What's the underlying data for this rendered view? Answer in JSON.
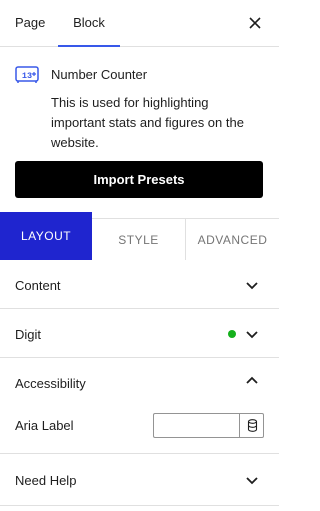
{
  "top_tabs": {
    "page": "Page",
    "block": "Block"
  },
  "block": {
    "icon": "number-counter-icon",
    "name": "Number Counter",
    "description": "This is used for highlighting important stats and figures on the website."
  },
  "import_button": "Import Presets",
  "panel_tabs": {
    "layout": "LAYOUT",
    "style": "STYLE",
    "advanced": "ADVANCED"
  },
  "sections": {
    "content": "Content",
    "digit": "Digit",
    "accessibility": "Accessibility",
    "need_help": "Need Help"
  },
  "accessibility": {
    "aria_label": "Aria Label",
    "aria_value": ""
  },
  "colors": {
    "accent": "#3858e9",
    "active_tab": "#1f25cf",
    "status_dot": "#15b01c"
  }
}
